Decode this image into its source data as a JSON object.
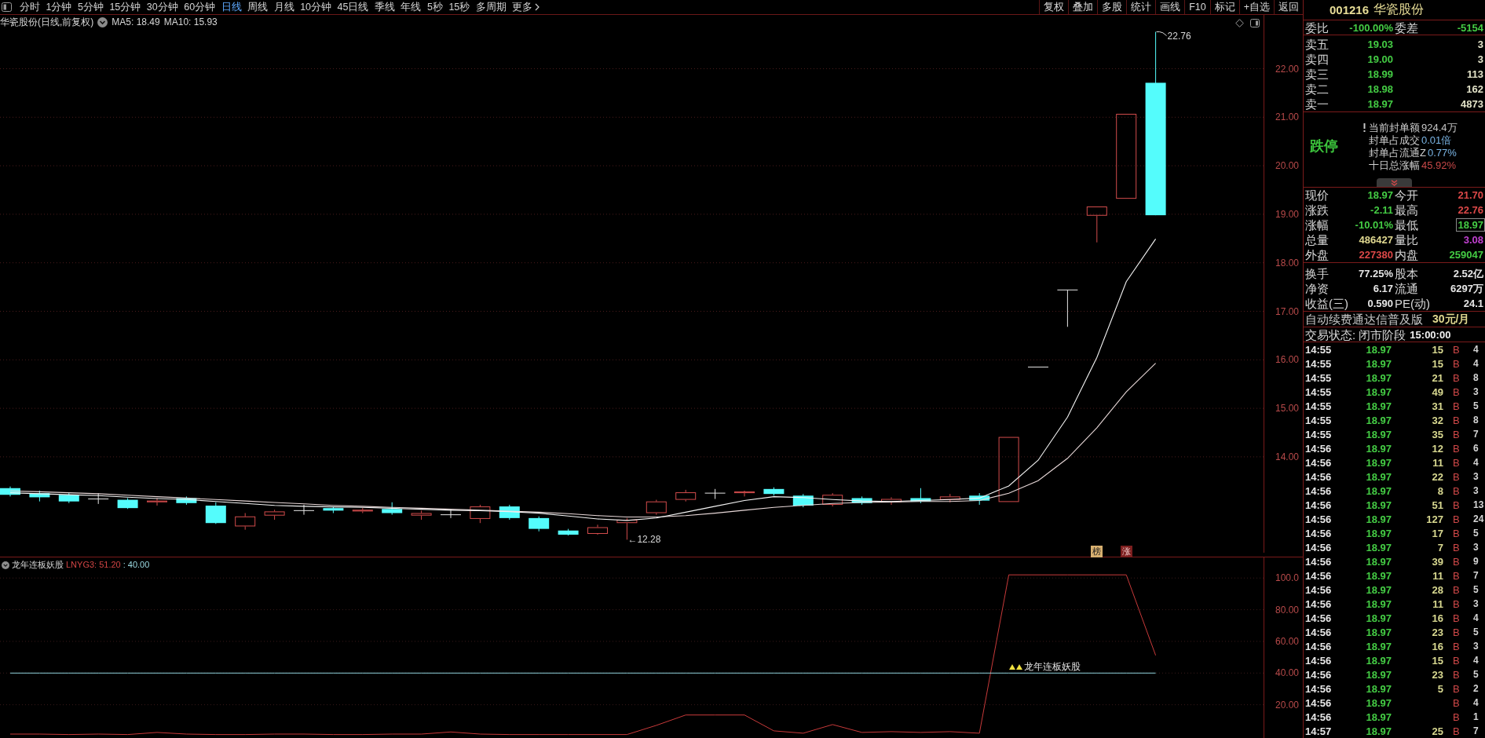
{
  "toolbar": {
    "periods": [
      {
        "label": "分时",
        "selected": false
      },
      {
        "label": "1分钟",
        "selected": false
      },
      {
        "label": "5分钟",
        "selected": false
      },
      {
        "label": "15分钟",
        "selected": false
      },
      {
        "label": "30分钟",
        "selected": false
      },
      {
        "label": "60分钟",
        "selected": false
      },
      {
        "label": "日线",
        "selected": true
      },
      {
        "label": "周线",
        "selected": false
      },
      {
        "label": "月线",
        "selected": false
      },
      {
        "label": "10分钟",
        "selected": false
      },
      {
        "label": "45日线",
        "selected": false
      },
      {
        "label": "季线",
        "selected": false
      },
      {
        "label": "年线",
        "selected": false
      },
      {
        "label": "5秒",
        "selected": false
      },
      {
        "label": "15秒",
        "selected": false
      },
      {
        "label": "多周期",
        "selected": false
      }
    ],
    "more": "更多",
    "actions": [
      "复权",
      "叠加",
      "多股",
      "统计",
      "画线",
      "F10",
      "标记",
      "+自选",
      "返回"
    ]
  },
  "main_chart": {
    "title": "华瓷股份(日线,前复权)",
    "moving_averages": [
      "MA5: 18.49",
      "MA10: 15.93"
    ],
    "price_axis": [
      "22.00",
      "21.00",
      "20.00",
      "19.00",
      "18.00",
      "17.00",
      "16.00",
      "15.00",
      "14.00"
    ],
    "high_label": "22.76",
    "low_label": "←12.28",
    "markers": [
      {
        "text": "榜",
        "color": "#d8b070"
      },
      {
        "text": "涨",
        "color": "#7c1e1e"
      }
    ]
  },
  "indicator": {
    "name": "龙年连板妖股",
    "readings": [
      {
        "text": "LNYG3: 51.20",
        "color": "#d04444"
      },
      {
        "text": ": 40.00",
        "color": "#9ad8e0"
      }
    ],
    "chart_data": {
      "type": "line",
      "grid": true,
      "ylim": [
        -1,
        113
      ],
      "yticks": [
        {
          "value": 100,
          "label": "100.0"
        },
        {
          "value": 80,
          "label": "80.00"
        },
        {
          "value": 60,
          "label": "60.00"
        },
        {
          "value": 40,
          "label": "40.00"
        },
        {
          "value": 20,
          "label": "20.00"
        }
      ],
      "series": [
        {
          "color": "#c83a3a",
          "values": [
            1.5,
            1.5,
            1.2,
            1.5,
            1.2,
            2.5,
            1.5,
            1.2,
            1.2,
            1.5,
            1.5,
            1.2,
            1.2,
            1.5,
            1.5,
            2.8,
            1.5,
            1.2,
            1.2,
            1.2,
            1.2,
            1.2,
            7,
            13.5,
            13.5,
            13.5,
            3.5,
            2,
            7.5,
            2.5,
            3,
            2.5,
            3,
            2,
            102,
            102,
            102,
            102,
            102,
            51.2
          ]
        },
        {
          "color": "#8fd3dc",
          "values": [
            40,
            40,
            40,
            40,
            40,
            40,
            40,
            40,
            40,
            40,
            40,
            40,
            40,
            40,
            40,
            40,
            40,
            40,
            40,
            40,
            40,
            40,
            40,
            40,
            40,
            40,
            40,
            40,
            40,
            40,
            40,
            40,
            40,
            40,
            40,
            40,
            40,
            40,
            40,
            40
          ]
        }
      ],
      "annotations": [
        {
          "text": "龙年连板妖股",
          "y": 40
        }
      ]
    }
  },
  "quote": {
    "code": "001216",
    "name": "华瓷股份",
    "summary": [
      {
        "label": "委比",
        "value": "-100.00%"
      },
      {
        "label": "委差",
        "value": "-5154"
      }
    ],
    "asks": [
      {
        "label": "卖五",
        "price": "19.03",
        "volume": "3"
      },
      {
        "label": "卖四",
        "price": "19.00",
        "volume": "3"
      },
      {
        "label": "卖三",
        "price": "18.99",
        "volume": "113"
      },
      {
        "label": "卖二",
        "price": "18.98",
        "volume": "162"
      },
      {
        "label": "卖一",
        "price": "18.97",
        "volume": "4873"
      }
    ],
    "limit": {
      "status": "跌停",
      "lines": [
        {
          "label": "当前封单额",
          "value": "924.4万",
          "color": "#c4c4c4",
          "alert": true
        },
        {
          "label": "封单占成交",
          "value": "0.01倍",
          "color": "#7ab4e4",
          "alert": false
        },
        {
          "label": "封单占流通Z",
          "value": "0.77%",
          "color": "#7ab4e4",
          "alert": false
        },
        {
          "label": "十日总涨幅",
          "value": "45.92%",
          "color": "#c84848",
          "alert": false
        }
      ]
    },
    "stats": [
      {
        "label": "现价",
        "value": "18.97",
        "color": "#44cc44",
        "highlighted": false
      },
      {
        "label": "今开",
        "value": "21.70",
        "color": "#dc4848",
        "highlighted": false
      },
      {
        "label": "涨跌",
        "value": "-2.11",
        "color": "#44cc44",
        "highlighted": false
      },
      {
        "label": "最高",
        "value": "22.76",
        "color": "#dc4848",
        "highlighted": false
      },
      {
        "label": "涨幅",
        "value": "-10.01%",
        "color": "#44cc44",
        "highlighted": false
      },
      {
        "label": "最低",
        "value": "18.97",
        "color": "#44cc44",
        "highlighted": true
      },
      {
        "label": "总量",
        "value": "486427",
        "color": "#e0d890",
        "highlighted": false
      },
      {
        "label": "量比",
        "value": "3.08",
        "color": "#c040d0",
        "highlighted": false
      },
      {
        "label": "外盘",
        "value": "227380",
        "color": "#dc4848",
        "highlighted": false
      },
      {
        "label": "内盘",
        "value": "259047",
        "color": "#44cc44",
        "highlighted": false
      }
    ],
    "fundamentals": [
      {
        "label": "换手",
        "value": "77.25%"
      },
      {
        "label": "股本",
        "value": "2.52亿"
      },
      {
        "label": "净资",
        "value": "6.17"
      },
      {
        "label": "流通",
        "value": "6297万"
      },
      {
        "label": "收益(三)",
        "value": "0.590"
      },
      {
        "label": "PE(动)",
        "value": "24.1"
      }
    ],
    "promo": {
      "text": "自动续费通达信普及版",
      "price": "30元/月"
    },
    "trade_status": {
      "label": "交易状态: 闭市阶段",
      "time": "15:00:00"
    },
    "ticks": [
      {
        "time": "14:55",
        "price": "18.97",
        "volume": "15",
        "side": "B",
        "column_5": "4"
      },
      {
        "time": "14:55",
        "price": "18.97",
        "volume": "15",
        "side": "B",
        "column_5": "4"
      },
      {
        "time": "14:55",
        "price": "18.97",
        "volume": "21",
        "side": "B",
        "column_5": "8"
      },
      {
        "time": "14:55",
        "price": "18.97",
        "volume": "49",
        "side": "B",
        "column_5": "3"
      },
      {
        "time": "14:55",
        "price": "18.97",
        "volume": "31",
        "side": "B",
        "column_5": "5"
      },
      {
        "time": "14:55",
        "price": "18.97",
        "volume": "32",
        "side": "B",
        "column_5": "8"
      },
      {
        "time": "14:55",
        "price": "18.97",
        "volume": "35",
        "side": "B",
        "column_5": "7"
      },
      {
        "time": "14:56",
        "price": "18.97",
        "volume": "12",
        "side": "B",
        "column_5": "6"
      },
      {
        "time": "14:56",
        "price": "18.97",
        "volume": "11",
        "side": "B",
        "column_5": "4"
      },
      {
        "time": "14:56",
        "price": "18.97",
        "volume": "22",
        "side": "B",
        "column_5": "3"
      },
      {
        "time": "14:56",
        "price": "18.97",
        "volume": "8",
        "side": "B",
        "column_5": "3"
      },
      {
        "time": "14:56",
        "price": "18.97",
        "volume": "51",
        "side": "B",
        "column_5": "13"
      },
      {
        "time": "14:56",
        "price": "18.97",
        "volume": "127",
        "side": "B",
        "column_5": "24"
      },
      {
        "time": "14:56",
        "price": "18.97",
        "volume": "17",
        "side": "B",
        "column_5": "5"
      },
      {
        "time": "14:56",
        "price": "18.97",
        "volume": "7",
        "side": "B",
        "column_5": "3"
      },
      {
        "time": "14:56",
        "price": "18.97",
        "volume": "39",
        "side": "B",
        "column_5": "9"
      },
      {
        "time": "14:56",
        "price": "18.97",
        "volume": "11",
        "side": "B",
        "column_5": "7"
      },
      {
        "time": "14:56",
        "price": "18.97",
        "volume": "28",
        "side": "B",
        "column_5": "5"
      },
      {
        "time": "14:56",
        "price": "18.97",
        "volume": "11",
        "side": "B",
        "column_5": "3"
      },
      {
        "time": "14:56",
        "price": "18.97",
        "volume": "16",
        "side": "B",
        "column_5": "4"
      },
      {
        "time": "14:56",
        "price": "18.97",
        "volume": "23",
        "side": "B",
        "column_5": "5"
      },
      {
        "time": "14:56",
        "price": "18.97",
        "volume": "16",
        "side": "B",
        "column_5": "3"
      },
      {
        "time": "14:56",
        "price": "18.97",
        "volume": "15",
        "side": "B",
        "column_5": "4"
      },
      {
        "time": "14:56",
        "price": "18.97",
        "volume": "23",
        "side": "B",
        "column_5": "5"
      },
      {
        "time": "14:56",
        "price": "18.97",
        "volume": "5",
        "side": "B",
        "column_5": "2"
      },
      {
        "time": "14:56",
        "price": "18.97",
        "side": "B",
        "column_5": "4"
      },
      {
        "time": "14:56",
        "price": "18.97",
        "side": "B",
        "column_5": "1"
      },
      {
        "time": "14:57",
        "price": "18.97",
        "volume": "25",
        "side": "B",
        "column_5": "7"
      }
    ]
  }
}
